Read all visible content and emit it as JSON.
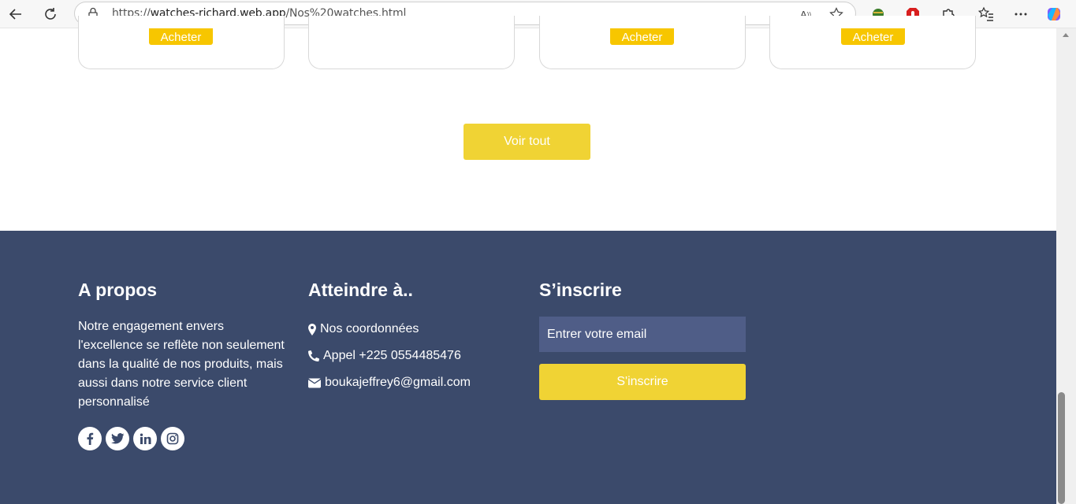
{
  "browser": {
    "url_prefix": "https://",
    "url_host": "watches-richard.web.app",
    "url_path": "/Nos%20watches.html"
  },
  "products": {
    "buy_label": "Acheter"
  },
  "voir_tout": "Voir tout",
  "footer": {
    "about_title": "A propos",
    "about_text": "Notre engagement envers l'excellence se reflète non seulement dans la qualité de nos produits, mais aussi dans notre service client personnalisé",
    "reach_title": "Atteindre à..",
    "contacts": {
      "coords": "Nos coordonnées",
      "phone": "Appel +225 0554485476",
      "email": "boukajeffrey6@gmail.com"
    },
    "subscribe_title": "S’inscrire",
    "email_placeholder": "Entrer votre email",
    "subscribe_button": "S'inscrire"
  },
  "social_icons": [
    "facebook-icon",
    "twitter-icon",
    "linkedin-icon",
    "instagram-icon"
  ],
  "colors": {
    "accent_yellow": "#f0d334",
    "buy_yellow": "#f7c600",
    "footer_bg": "#3b4a6b",
    "input_bg": "#4f5d87"
  }
}
